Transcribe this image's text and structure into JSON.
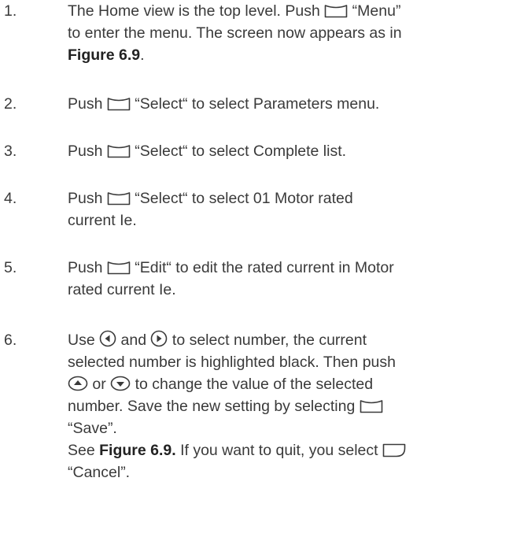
{
  "steps": [
    {
      "number": "1.",
      "lines": [
        {
          "pre": "The Home view is the top level. Push ",
          "post": " “Menu”"
        },
        {
          "text": "to enter the menu. The screen now appears as in"
        },
        {
          "bold": "Figure 6.9",
          "after": "."
        }
      ]
    },
    {
      "number": "2.",
      "lines": [
        {
          "pre": "Push ",
          "post": " “Select“ to select Parameters menu."
        }
      ]
    },
    {
      "number": "3.",
      "lines": [
        {
          "pre": "Push ",
          "post": " “Select“ to select Complete list."
        }
      ]
    },
    {
      "number": "4.",
      "lines": [
        {
          "pre": "Push ",
          "post": " “Select“ to select 01 Motor rated"
        },
        {
          "text": "current Ie."
        }
      ]
    },
    {
      "number": "5.",
      "lines": [
        {
          "pre": "Push ",
          "post": " “Edit“ to edit the rated current in Motor"
        },
        {
          "text": "rated current Ie."
        }
      ]
    },
    {
      "number": "6.",
      "lines": [
        {
          "use": "Use ",
          "and": " and ",
          "rest": " to select number, the current"
        },
        {
          "text": "selected number is highlighted black. Then push"
        },
        {
          "or": " or ",
          "rest": " to change the value of the selected"
        },
        {
          "text": "number. Save the new setting by selecting "
        },
        {
          "text": "“Save”."
        },
        {
          "see": "See ",
          "bold": "Figure 6.9.",
          "after": " If you want to quit, you select "
        },
        {
          "text": "“Cancel”."
        }
      ]
    }
  ]
}
